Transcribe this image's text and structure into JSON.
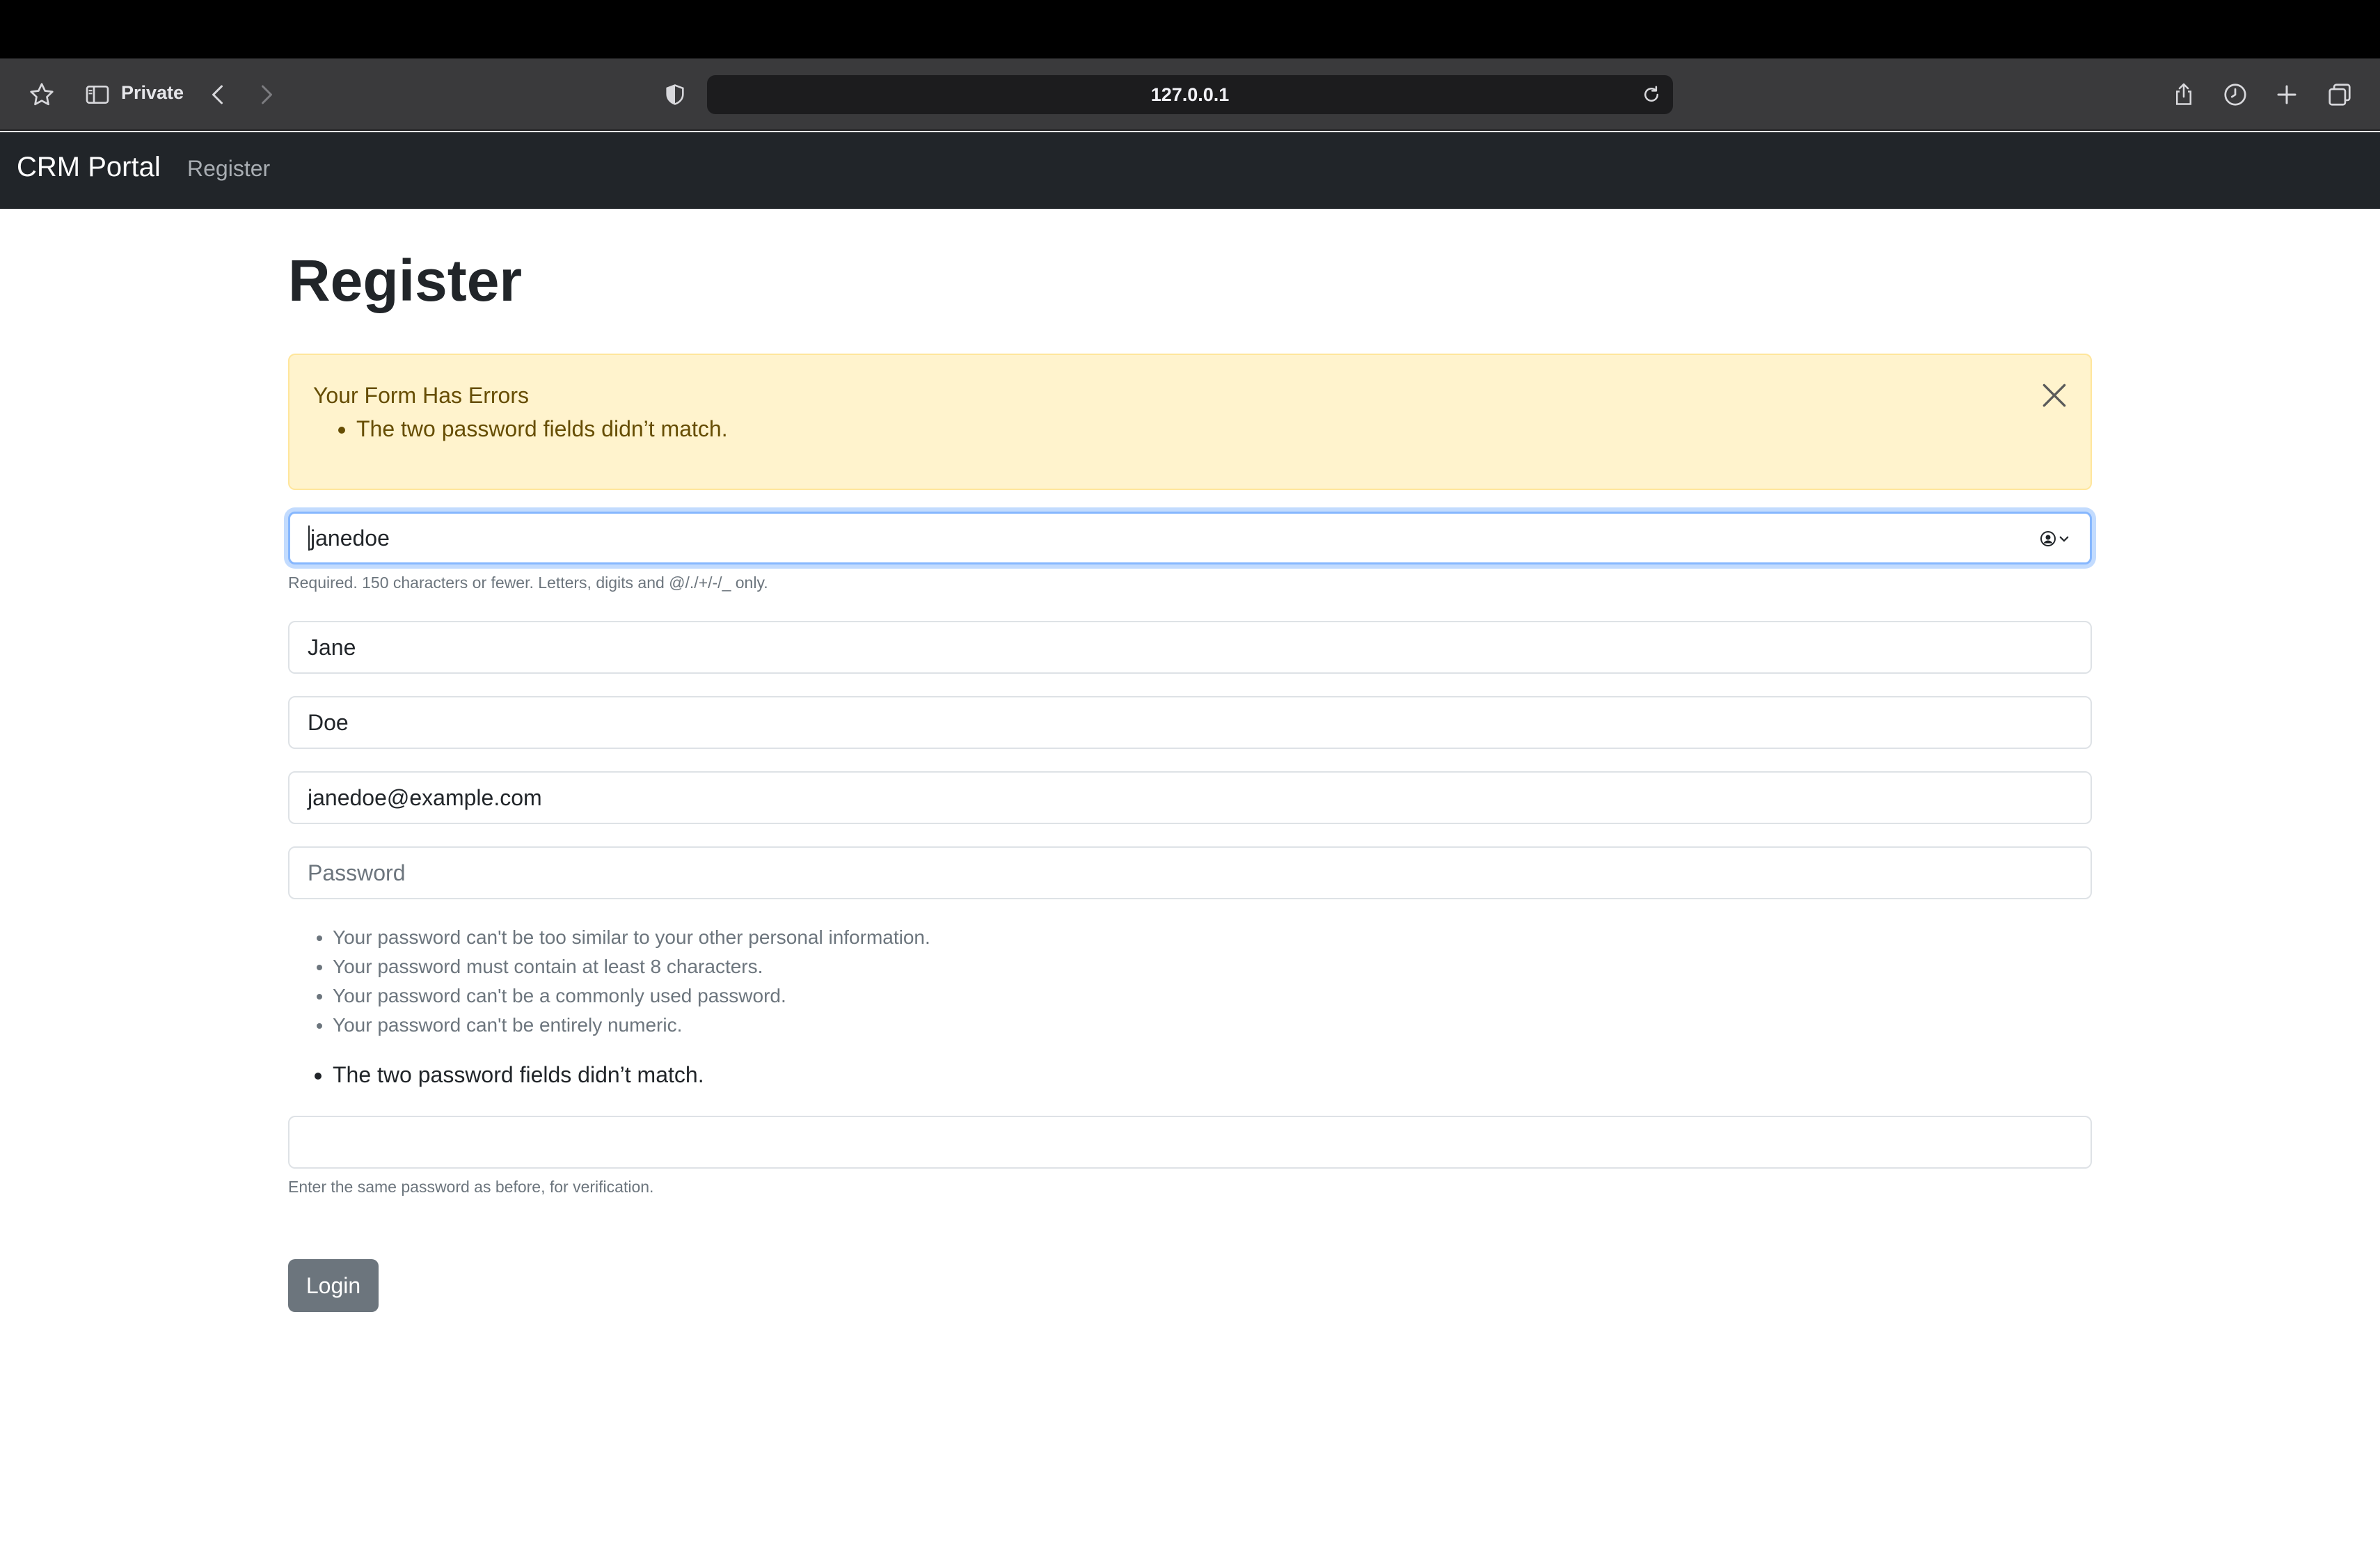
{
  "browser": {
    "mode_label": "Private",
    "url": "127.0.0.1",
    "icons": [
      "star-icon",
      "sidebar-icon",
      "back-icon",
      "forward-icon",
      "shield-icon",
      "reload-icon",
      "share-icon",
      "history-icon",
      "new-tab-icon",
      "tabs-overview-icon"
    ]
  },
  "navbar": {
    "brand": "CRM Portal",
    "links": [
      "Register"
    ]
  },
  "page": {
    "title": "Register"
  },
  "alert": {
    "title": "Your Form Has Errors",
    "errors": [
      "The two password fields didn’t match."
    ]
  },
  "form": {
    "username": {
      "value": "janedoe",
      "help": "Required. 150 characters or fewer. Letters, digits and @/./+/-/_ only."
    },
    "first_name": {
      "value": "Jane"
    },
    "last_name": {
      "value": "Doe"
    },
    "email": {
      "value": "janedoe@example.com"
    },
    "password1": {
      "placeholder": "Password",
      "value": "",
      "help_items": [
        "Your password can't be too similar to your other personal information.",
        "Your password must contain at least 8 characters.",
        "Your password can't be a commonly used password.",
        "Your password can't be entirely numeric."
      ]
    },
    "password2": {
      "errors": [
        "The two password fields didn’t match."
      ],
      "value": "",
      "help": "Enter the same password as before, for verification."
    },
    "submit_label": "Login"
  },
  "colors": {
    "navbar_bg": "#212529",
    "alert_bg": "#fff3cd",
    "alert_text": "#664d03",
    "focus_border": "#86b7fe",
    "button_bg": "#6c757d"
  }
}
